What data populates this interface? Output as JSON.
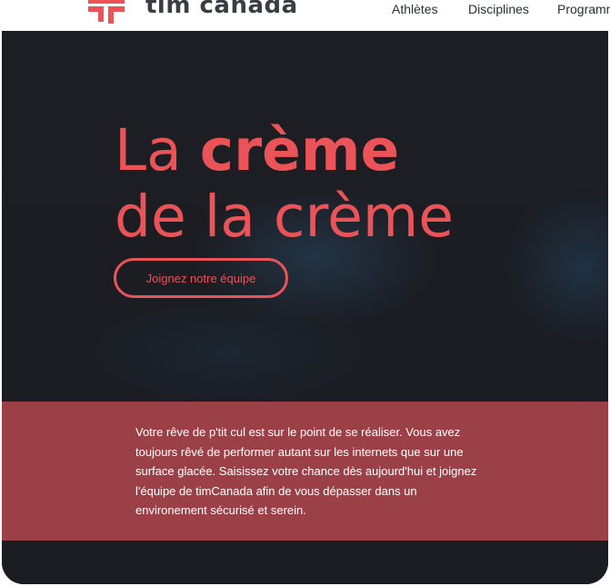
{
  "header": {
    "brand": "tim canada",
    "nav": [
      {
        "label": "Athlètes"
      },
      {
        "label": "Disciplines"
      },
      {
        "label": "Programmes"
      }
    ]
  },
  "hero": {
    "headline_light": "La ",
    "headline_strong": "crème",
    "headline_line2": "de la crème",
    "cta_label": "Joignez notre équipe"
  },
  "band": {
    "text": "Votre rêve de p'tit cul est sur le point de se réaliser. Vous avez toujours rêvé de performer autant sur les internets que sur une surface glacée. Saisissez votre chance dès aujourd'hui et joignez l'équipe de timCanada afin de vous dépasser dans un environement sécurisé et serein."
  },
  "colors": {
    "accent": "#ea5358",
    "band": "#9c4047",
    "hero_bg": "#1b1c22",
    "header_text": "#3a3d44"
  }
}
